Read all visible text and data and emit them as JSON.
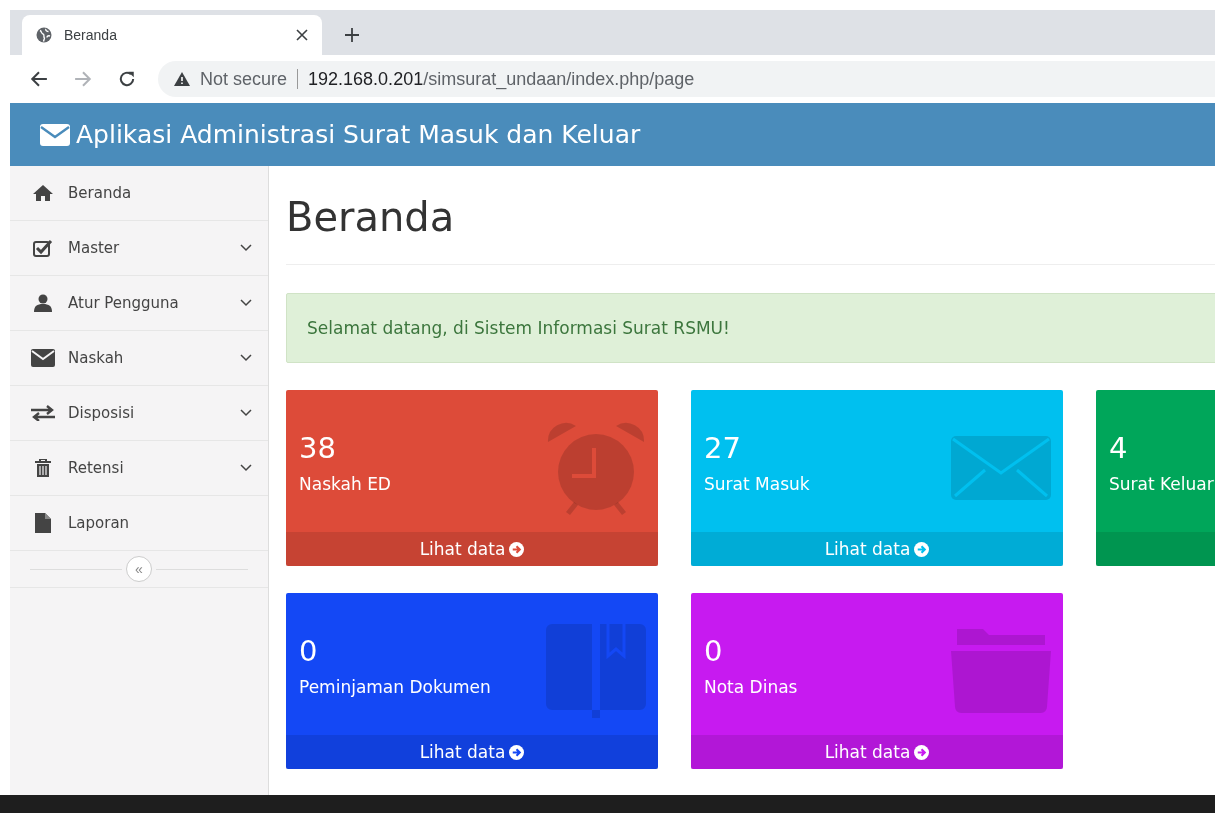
{
  "browser": {
    "tab": {
      "title": "Beranda"
    },
    "address": {
      "warning": "Not secure",
      "host": "192.168.0.201",
      "path": "/simsurat_undaan/index.php/page"
    }
  },
  "header": {
    "title": "Aplikasi Administrasi Surat Masuk dan Keluar"
  },
  "sidebar": {
    "items": [
      {
        "label": "Beranda",
        "has_submenu": false
      },
      {
        "label": "Master",
        "has_submenu": true
      },
      {
        "label": "Atur Pengguna",
        "has_submenu": true
      },
      {
        "label": "Naskah",
        "has_submenu": true
      },
      {
        "label": "Disposisi",
        "has_submenu": true
      },
      {
        "label": "Retensi",
        "has_submenu": true
      },
      {
        "label": "Laporan",
        "has_submenu": false
      }
    ],
    "collapse": "«"
  },
  "page": {
    "title": "Beranda",
    "alert": "Selamat datang, di Sistem Informasi Surat RSMU!"
  },
  "cards": [
    {
      "count": "38",
      "label": "Naskah ED",
      "link": "Lihat data",
      "color": "#dd4b39"
    },
    {
      "count": "27",
      "label": "Surat Masuk",
      "link": "Lihat data",
      "color": "#00c0ef"
    },
    {
      "count": "4",
      "label": "Surat Keluar",
      "color": "#00a65a"
    },
    {
      "count": "0",
      "label": "Peminjaman Dokumen",
      "link": "Lihat data",
      "color": "#1448f5"
    },
    {
      "count": "0",
      "label": "Nota Dinas",
      "link": "Lihat data",
      "color": "#c71af0"
    }
  ]
}
